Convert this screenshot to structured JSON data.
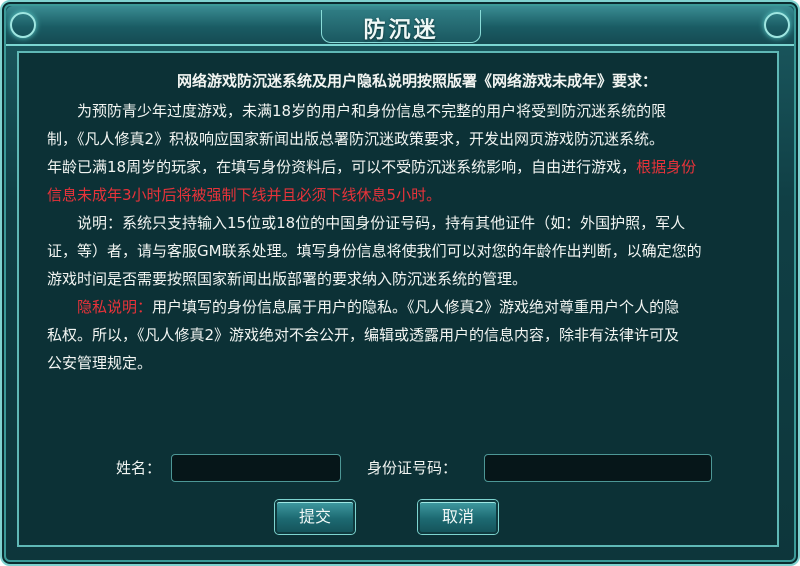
{
  "window": {
    "title": "防沉迷"
  },
  "content": {
    "heading": "网络游戏防沉迷系统及用户隐私说明按照版署《网络游戏未成年》要求：",
    "p1_line1": "为预防青少年过度游戏，未满18岁的用户和身份信息不完整的用户将受到防沉迷系统的限",
    "p1_line2": "制，《凡人修真2》积极响应国家新闻出版总署防沉迷政策要求，开发出网页游戏防沉迷系统。",
    "p2_line1_normal": "年龄已满18周岁的玩家，在填写身份资料后，可以不受防沉迷系统影响，自由进行游戏，",
    "p2_line1_red": "根据身份",
    "p2_line2_red": "信息未成年3小时后将被强制下线并且必须下线休息5小时。",
    "p3_line1": "说明：系统只支持输入15位或18位的中国身份证号码，持有其他证件（如：外国护照，军人",
    "p3_line2": "证，等）者，请与客服GM联系处理。填写身份信息将使我们可以对您的年龄作出判断，以确定您的",
    "p3_line3": "游戏时间是否需要按照国家新闻出版部署的要求纳入防沉迷系统的管理。",
    "p4_label": "隐私说明：",
    "p4_line1": "用户填写的身份信息属于用户的隐私。《凡人修真2》游戏绝对尊重用户个人的隐",
    "p4_line2": "私权。所以，《凡人修真2》游戏绝对不会公开，编辑或透露用户的信息内容，除非有法律许可及",
    "p4_line3": "公安管理规定。"
  },
  "form": {
    "name_label": "姓名：",
    "name_value": "",
    "id_label": "身份证号码：",
    "id_value": ""
  },
  "buttons": {
    "submit_label": "提交",
    "cancel_label": "取消"
  }
}
